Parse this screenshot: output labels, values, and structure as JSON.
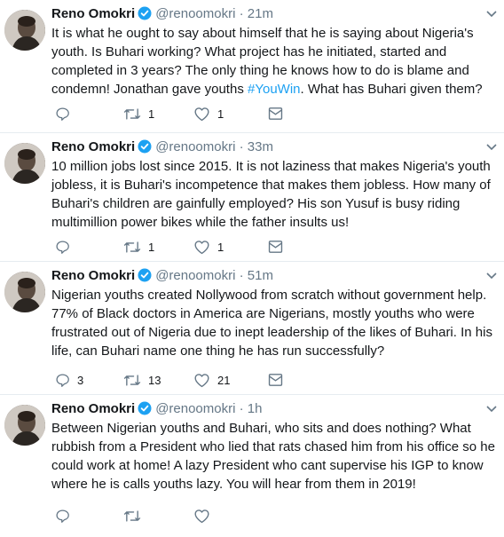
{
  "tweets": [
    {
      "name": "Reno Omokri",
      "handle": "@renoomokri",
      "separator": "·",
      "time": "21m",
      "text_before": "It is what he ought to say about himself that he is saying about Nigeria's youth. Is Buhari working? What project has he initiated, started and completed in 3 years? The only thing he knows how to do is blame and condemn! Jonathan gave youths ",
      "hashtag": "#YouWin",
      "text_after": ". What has Buhari given them?",
      "replies": "",
      "retweets": "1",
      "likes": "1"
    },
    {
      "name": "Reno Omokri",
      "handle": "@renoomokri",
      "separator": "·",
      "time": "33m",
      "text_before": "10 million jobs lost since 2015. It is not laziness that makes Nigeria's youth jobless, it is Buhari's incompetence that makes them jobless. How many of Buhari's children are gainfully employed? His son Yusuf is busy riding multimillion power bikes while the father insults us!",
      "hashtag": "",
      "text_after": "",
      "replies": "",
      "retweets": "1",
      "likes": "1"
    },
    {
      "name": "Reno Omokri",
      "handle": "@renoomokri",
      "separator": "·",
      "time": "51m",
      "text_before": "Nigerian youths created Nollywood from scratch without government help. 77% of Black doctors in America are Nigerians, mostly youths who were frustrated out of Nigeria due to inept leadership of the likes of Buhari. In his life, can Buhari name one thing he has run successfully?",
      "hashtag": "",
      "text_after": "",
      "replies": "3",
      "retweets": "13",
      "likes": "21"
    },
    {
      "name": "Reno Omokri",
      "handle": "@renoomokri",
      "separator": "·",
      "time": "1h",
      "text_before": "Between Nigerian youths and Buhari, who sits and does nothing? What rubbish from a President who lied that rats chased him from his office so he could work at home! A lazy President who cant supervise his IGP to know where he is calls youths lazy. You will hear from them in 2019!",
      "hashtag": "",
      "text_after": "",
      "replies": "",
      "retweets": "",
      "likes": ""
    }
  ],
  "colors": {
    "link": "#1da1f2",
    "muted": "#657786",
    "text": "#14171a",
    "divider": "#e6ecf0",
    "verified": "#1da1f2"
  },
  "icons": [
    "reply-icon",
    "retweet-icon",
    "like-icon",
    "dm-icon",
    "verified-icon",
    "caret-down-icon"
  ]
}
